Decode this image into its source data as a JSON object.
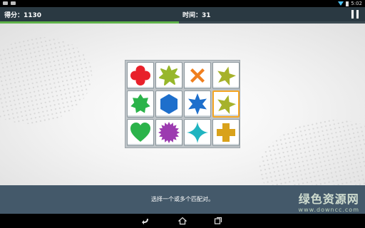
{
  "status_bar": {
    "time": "5:02"
  },
  "header": {
    "score_label": "得分：",
    "score_value": "1130",
    "time_label": "时间：",
    "time_value": "31",
    "progress": 0.49,
    "progress_color": "#5fb24a"
  },
  "board": {
    "rows": 3,
    "cols": 4,
    "selected_index": 7,
    "selection_color": "#f5a623",
    "tiles": [
      {
        "shape": "flower-icon",
        "color": "#e8202a"
      },
      {
        "shape": "splat-icon",
        "color": "#97b72b"
      },
      {
        "shape": "x-icon",
        "color": "#f07f1e"
      },
      {
        "shape": "star-icon",
        "color": "#a6b22b"
      },
      {
        "shape": "star-burst-icon",
        "color": "#2bb34a"
      },
      {
        "shape": "hexagon-icon",
        "color": "#1e6fcc"
      },
      {
        "shape": "six-point-star-icon",
        "color": "#1e6fcc"
      },
      {
        "shape": "star-icon",
        "color": "#a6b22b"
      },
      {
        "shape": "heart-icon",
        "color": "#2bb34a"
      },
      {
        "shape": "sun-burst-icon",
        "color": "#9c3bb0"
      },
      {
        "shape": "diamond-star-icon",
        "color": "#20b4c0"
      },
      {
        "shape": "plus-icon",
        "color": "#d9a21b"
      }
    ]
  },
  "hint": {
    "text": "选择一个或多个匹配对。"
  },
  "watermark": {
    "title": "绿色资源网",
    "url": "www.downcc.com"
  }
}
